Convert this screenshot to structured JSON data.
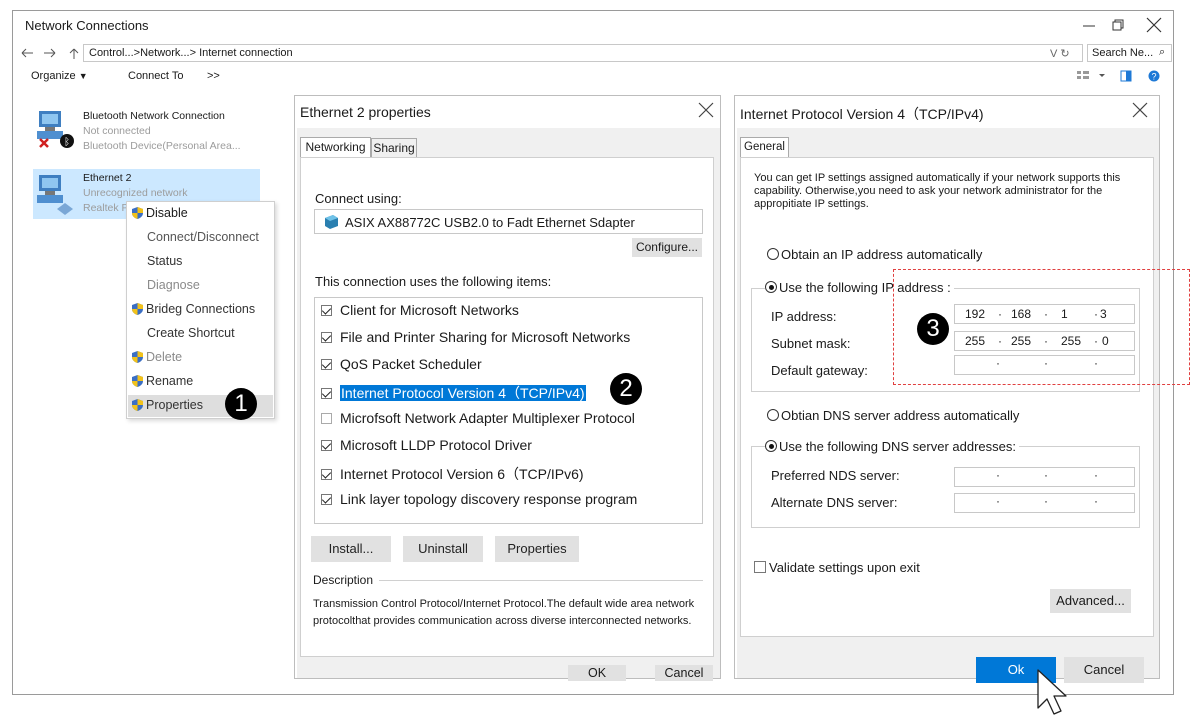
{
  "window": {
    "title": "Network Connections"
  },
  "address_bar": {
    "path_1": "Control...",
    "path_2": "Network...",
    "path_3": "Internet connection",
    "search_placeholder": "Search Ne..."
  },
  "toolbar": {
    "organize": "Organize",
    "connect_to": "Connect To",
    "more": ">>"
  },
  "connections": [
    {
      "name": "Bluetooth Network Connection",
      "status": "Not connected",
      "device": "Bluetooth Device(Personal Area..."
    },
    {
      "name": "Ethernet 2",
      "status": "Unrecognized network",
      "device": "Realtek P"
    }
  ],
  "context_menu": {
    "items": [
      "Disable",
      "Connect/Disconnect",
      "Status",
      "Diagnose",
      "Brideg Connections",
      "Create Shortcut",
      "Delete",
      "Rename",
      "Properties"
    ]
  },
  "eth_props": {
    "title": "Ethernet 2 properties",
    "tabs": [
      "Networking",
      "Sharing"
    ],
    "connect_using_label": "Connect using:",
    "adapter": "ASIX AX88772C USB2.0 to Fadt Ethernet Sdapter",
    "configure": "Configure...",
    "items_label": "This connection uses the following items:",
    "items": [
      "Client for Microsoft Networks",
      "File and Printer Sharing for Microsoft Networks",
      "QoS Packet Scheduler",
      "Internet Protocol Version 4（TCP/IPv4)",
      "Microfsoft Network Adapter Multiplexer Protocol",
      "Microsoft LLDP Protocol Driver",
      "Internet Protocol Version 6（TCP/IPv6)",
      "Link layer topology discovery response program"
    ],
    "install": "Install...",
    "uninstall": "Uninstall",
    "properties": "Properties",
    "description_label": "Description",
    "description": "Transmission Control Protocol/Internet Protocol.The default wide area network protocolthat provides communication across diverse interconnected networks.",
    "ok": "OK",
    "cancel": "Cancel"
  },
  "ipv4": {
    "title": "Internet Protocol Version 4（TCP/IPv4)",
    "tab": "General",
    "intro": "You can get IP settings assigned automatically if your network supports this capability. Otherwise,you need to ask your network administrator for the appropitiate IP settings.",
    "obtain_ip": "Obtain an IP address automatically",
    "use_ip": "Use the following IP address :",
    "ip_label": "IP address:",
    "mask_label": "Subnet mask:",
    "gateway_label": "Default gateway:",
    "ip": [
      "192",
      "168",
      "1",
      "3"
    ],
    "mask": [
      "255",
      "255",
      "255",
      "0"
    ],
    "obtain_dns": "Obtian DNS server address automatically",
    "use_dns": "Use the following DNS server addresses:",
    "preferred_dns": "Preferred NDS server:",
    "alternate_dns": "Alternate DNS server:",
    "validate": "Validate settings upon exit",
    "advanced": "Advanced...",
    "ok": "Ok",
    "cancel": "Cancel"
  },
  "markers": [
    "1",
    "2",
    "3"
  ],
  "colors": {
    "selection": "#0078d7",
    "highlight_bg": "#cce8ff",
    "callout": "#e04040"
  }
}
